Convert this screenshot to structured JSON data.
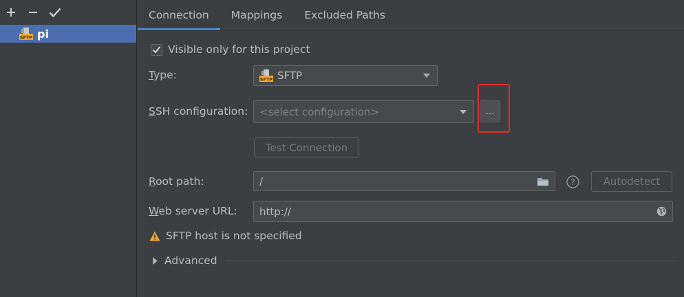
{
  "sidebar": {
    "toolbar": {
      "add_glyph": "+",
      "remove_glyph": "−",
      "apply_glyph": "✔"
    },
    "servers": [
      {
        "name": "pi",
        "icon": "sftp-icon"
      }
    ]
  },
  "tabs": [
    {
      "label": "Connection",
      "active": true
    },
    {
      "label": "Mappings",
      "active": false
    },
    {
      "label": "Excluded Paths",
      "active": false
    }
  ],
  "connection": {
    "visible_only_label": "Visible only for this project",
    "visible_only_checked": true,
    "type_label_mnemonic": "T",
    "type_label_rest": "ype:",
    "type_value": "SFTP",
    "ssh_label_mnemonic": "S",
    "ssh_label_rest": "SH configuration:",
    "ssh_placeholder": "<select configuration>",
    "ssh_more_button": "...",
    "test_connection_button": "Test Connection",
    "root_path_label_mnemonic": "R",
    "root_path_label_rest": "oot path:",
    "root_path_value": "/",
    "autodetect_button": "Autodetect",
    "web_url_label_mnemonic": "W",
    "web_url_label_rest": "eb server URL:",
    "web_url_value": "http://",
    "warning_text": "SFTP host is not specified",
    "advanced_label": "Advanced"
  },
  "colors": {
    "selection": "#4b6eaf",
    "tab_underline": "#4a88c7",
    "highlight_box": "#e32b2b",
    "warning": "#f0a732"
  }
}
